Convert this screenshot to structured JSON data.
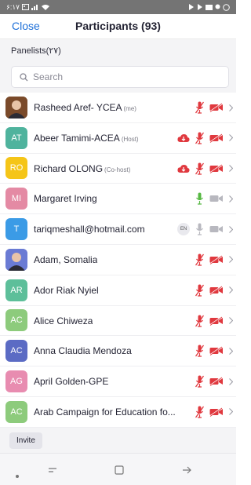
{
  "status_bar": {
    "left_text": "۶:۱۷",
    "icons": [
      "dot-icon",
      "image-icon",
      "signal-icon",
      "wifi-icon",
      "play-icon",
      "play-icon",
      "mail-icon",
      "location-icon",
      "whatsapp-icon"
    ]
  },
  "header": {
    "close_label": "Close",
    "title": "Participants (93)"
  },
  "section": {
    "label": "Panelists(۲۷)"
  },
  "search": {
    "placeholder": "Search"
  },
  "colors": {
    "accent": "#1d6fd8",
    "muted_red": "#e0383e",
    "mic_on": "#57b843"
  },
  "participants": [
    {
      "initials": "",
      "avatar_color": "#7a4a2a",
      "photo": true,
      "name": "Rasheed Aref- YCEA",
      "role": "(me)",
      "cloud": false,
      "en": false,
      "mic": "muted",
      "video": "off"
    },
    {
      "initials": "AT",
      "avatar_color": "#4fb39d",
      "photo": false,
      "name": "Abeer Tamimi-ACEA",
      "role": "(Host)",
      "cloud": true,
      "en": false,
      "mic": "muted",
      "video": "off"
    },
    {
      "initials": "RO",
      "avatar_color": "#f5c518",
      "photo": false,
      "name": "Richard OLONG",
      "role": "(Co-host)",
      "cloud": true,
      "en": false,
      "mic": "muted",
      "video": "off"
    },
    {
      "initials": "MI",
      "avatar_color": "#e48aa4",
      "photo": false,
      "name": "Margaret Irving",
      "role": "",
      "cloud": false,
      "en": false,
      "mic": "on",
      "video": "idle"
    },
    {
      "initials": "T",
      "avatar_color": "#3b9be6",
      "photo": false,
      "name": "tariqmeshall@hotmail.com",
      "role": "",
      "cloud": false,
      "en": true,
      "en_label": "EN",
      "mic": "idle",
      "video": "idle"
    },
    {
      "initials": "",
      "avatar_color": "#6a7bd4",
      "photo": true,
      "name": "Adam, Somalia",
      "role": "",
      "cloud": false,
      "en": false,
      "mic": "muted",
      "video": "off"
    },
    {
      "initials": "AR",
      "avatar_color": "#5dbf9a",
      "photo": false,
      "name": "Ador Riak Nyiel",
      "role": "",
      "cloud": false,
      "en": false,
      "mic": "muted",
      "video": "off"
    },
    {
      "initials": "AC",
      "avatar_color": "#8dcb7c",
      "photo": false,
      "name": "Alice Chiweza",
      "role": "",
      "cloud": false,
      "en": false,
      "mic": "muted",
      "video": "off"
    },
    {
      "initials": "AC",
      "avatar_color": "#5b6bc4",
      "photo": false,
      "name": "Anna Claudia Mendoza",
      "role": "",
      "cloud": false,
      "en": false,
      "mic": "muted",
      "video": "off"
    },
    {
      "initials": "AG",
      "avatar_color": "#e88cb0",
      "photo": false,
      "name": "April Golden-GPE",
      "role": "",
      "cloud": false,
      "en": false,
      "mic": "muted",
      "video": "off"
    },
    {
      "initials": "AC",
      "avatar_color": "#8dcb7c",
      "photo": false,
      "name": "Arab Campaign for Education fo...",
      "role": "",
      "cloud": false,
      "en": false,
      "mic": "muted",
      "video": "off"
    }
  ],
  "footer": {
    "invite_label": "Invite"
  },
  "nav": {
    "icons": [
      "dot-icon",
      "recent-apps-icon",
      "home-icon",
      "back-icon"
    ]
  }
}
